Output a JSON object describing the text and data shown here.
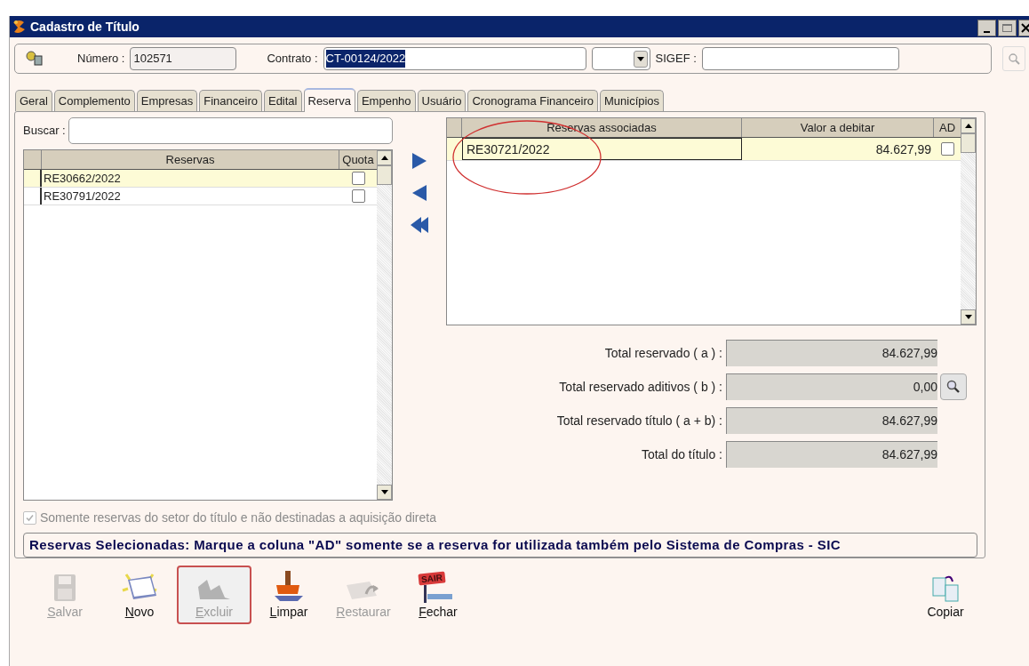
{
  "window": {
    "title": "Cadastro de Título"
  },
  "header": {
    "numero_label": "Número :",
    "numero": "102571",
    "contrato_label": "Contrato :",
    "contrato": "CT-00124/2022",
    "sigef_label": "SIGEF :"
  },
  "tabs": [
    {
      "label": "Geral",
      "selected": false
    },
    {
      "label": "Complemento",
      "selected": false
    },
    {
      "label": "Empresas",
      "selected": false
    },
    {
      "label": "Financeiro",
      "selected": false
    },
    {
      "label": "Edital",
      "selected": false
    },
    {
      "label": "Reserva",
      "selected": true
    },
    {
      "label": "Empenho",
      "selected": false
    },
    {
      "label": "Usuário",
      "selected": false
    },
    {
      "label": "Cronograma Financeiro",
      "selected": false
    },
    {
      "label": "Municípios",
      "selected": false
    }
  ],
  "search": {
    "label": "Buscar :"
  },
  "available_table": {
    "columns": [
      "Reservas",
      "Quota"
    ],
    "rows": [
      {
        "reserva": "RE30662/2022",
        "quota": false,
        "selected": true
      },
      {
        "reserva": "RE30791/2022",
        "quota": false,
        "selected": false
      }
    ]
  },
  "associated_table": {
    "columns": [
      "Reservas associadas",
      "Valor a debitar",
      "AD"
    ],
    "rows": [
      {
        "reserva": "RE30721/2022",
        "valor": "84.627,99",
        "ad": false,
        "selected": true,
        "circled": true
      }
    ]
  },
  "totals": [
    {
      "label": "Total reservado ( a ) :",
      "value": "84.627,99",
      "lookup": false
    },
    {
      "label": "Total reservado aditivos ( b ) :",
      "value": "0,00",
      "lookup": true
    },
    {
      "label": "Total reservado título ( a + b) :",
      "value": "84.627,99",
      "lookup": false
    },
    {
      "label": "Total do título :",
      "value": "84.627,99",
      "lookup": false
    }
  ],
  "filter_checkbox": {
    "label": "Somente reservas do setor do título e não destinadas a aquisição direta",
    "checked": true,
    "disabled": true
  },
  "message": "Reservas Selecionadas: Marque a coluna \"AD\" somente se a reserva for utilizada também pelo Sistema de Compras - SIC",
  "toolbar": [
    {
      "kind": "save",
      "label": "Salvar",
      "disabled": true,
      "focused": false,
      "mnemonic": true
    },
    {
      "kind": "new",
      "label": "Novo",
      "disabled": false,
      "focused": false,
      "mnemonic": true
    },
    {
      "kind": "delete",
      "label": "Excluir",
      "disabled": true,
      "focused": true,
      "mnemonic": true
    },
    {
      "kind": "clear",
      "label": "Limpar",
      "disabled": false,
      "focused": false,
      "mnemonic": true
    },
    {
      "kind": "restore",
      "label": "Restaurar",
      "disabled": true,
      "focused": false,
      "mnemonic": true
    },
    {
      "kind": "exit",
      "label": "Fechar",
      "disabled": false,
      "focused": false,
      "mnemonic": true,
      "sign": "SAIR"
    },
    {
      "kind": "copy",
      "label": "Copiar",
      "disabled": false,
      "focused": false,
      "mnemonic": false
    }
  ]
}
